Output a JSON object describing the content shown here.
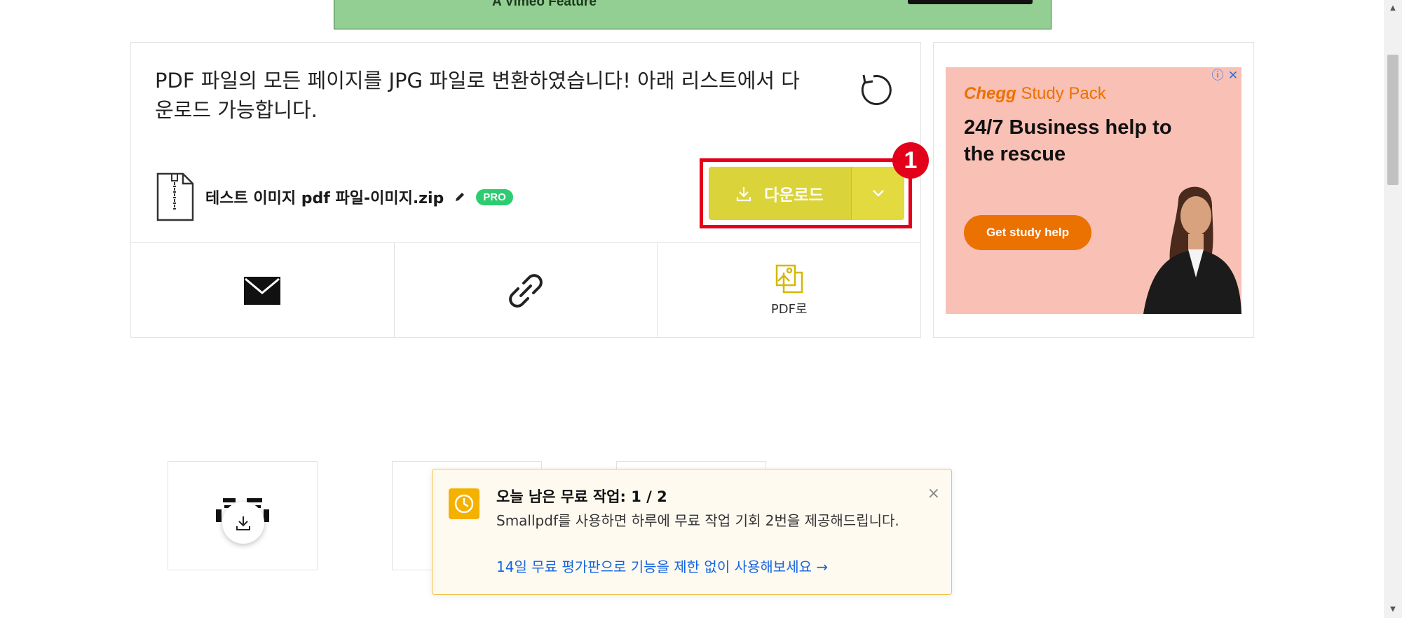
{
  "banner": {
    "text": "A Vimeo Feature"
  },
  "result": {
    "message": "PDF 파일의 모든 페이지를 JPG 파일로 변환하였습니다! 아래 리스트에서 다운로드 가능합니다.",
    "file_name": "테스트 이미지 pdf 파일-이미지.zip",
    "pro_badge": "PRO",
    "download_label": "다운로드",
    "step_number": "1",
    "actions": [
      {
        "icon": "email-icon",
        "label": ""
      },
      {
        "icon": "link-icon",
        "label": ""
      },
      {
        "icon": "image-to-pdf-icon",
        "label": "PDF로"
      }
    ]
  },
  "ad": {
    "brand": "Chegg",
    "brand_suffix": "Study Pack",
    "headline": "24/7 Business help to the rescue",
    "cta": "Get study help",
    "brand_color": "#eb7100",
    "background_color": "#f9c0b5"
  },
  "toast": {
    "title": "오늘 남은 무료 작업: 1 / 2",
    "body": "Smallpdf를 사용하면 하루에 무료 작업 기회 2번을 제공해드립니다.",
    "link": "14일 무료 평가판으로 기능을 제한 없이 사용해보세요 →",
    "close": "×"
  },
  "colors": {
    "download_button": "#dbd33a",
    "highlight_red": "#e3001b",
    "pro_green": "#2ecc71",
    "toast_border": "#f6c24d",
    "link_blue": "#1565e0"
  }
}
